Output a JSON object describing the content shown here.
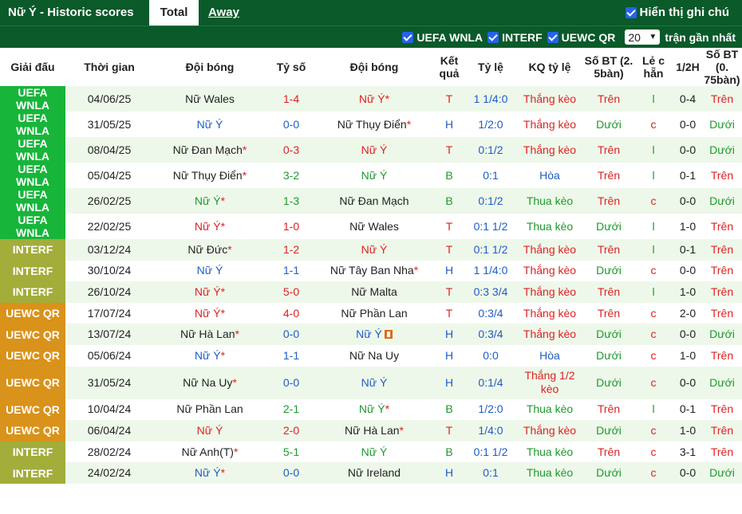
{
  "header": {
    "title": "Nữ Ý - Historic scores",
    "tab_total": "Total",
    "tab_away": "Away",
    "show_label": "Hiển thị ghi chú"
  },
  "filters": {
    "leagues": [
      "UEFA WNLA",
      "INTERF",
      "UEWC QR"
    ],
    "count": "20",
    "count_label": "trận gần nhất"
  },
  "colors": {
    "header_bg": "#0a5a2a",
    "league_uefa": "#17b53a",
    "league_interf": "#a2ad3a",
    "league_uewc": "#d9921a",
    "win": "#d22",
    "draw": "#1e5cc8",
    "loss": "#1d9a2c"
  },
  "columns": [
    "Giải đấu",
    "Thời gian",
    "Đội bóng",
    "Tỷ số",
    "Đội bóng",
    "Kết quả",
    "Tỷ lệ",
    "KQ tỷ lệ",
    "Số BT (2. 5bàn)",
    "Lẻ c hẵn",
    "1/2H",
    "Số BT (0. 75bàn)"
  ],
  "rows": [
    {
      "league": "UEFA WNLA",
      "lc": "uefa",
      "date": "04/06/25",
      "home": "Nữ Wales",
      "hc": "dark",
      "hs": false,
      "score": "1-4",
      "away": "Nữ Ý",
      "ac": "red",
      "as": true,
      "res": "T",
      "rc": "red",
      "odds": "1 1/4:0",
      "oc": "blue",
      "kq": "Thắng kèo",
      "kc": "red",
      "ou": "Trên",
      "uc": "red",
      "eo": "l",
      "ec": "green",
      "half": "0-4",
      "ou2": "Trên",
      "u2c": "red"
    },
    {
      "league": "UEFA WNLA",
      "lc": "uefa",
      "date": "31/05/25",
      "home": "Nữ Ý",
      "hc": "blue",
      "hs": false,
      "score": "0-0",
      "away": "Nữ Thụy Điển",
      "ac": "dark",
      "as": true,
      "res": "H",
      "rc": "blue",
      "odds": "1/2:0",
      "oc": "blue",
      "kq": "Thắng kèo",
      "kc": "red",
      "ou": "Dưới",
      "uc": "green",
      "eo": "c",
      "ec": "red",
      "half": "0-0",
      "ou2": "Dưới",
      "u2c": "green"
    },
    {
      "league": "UEFA WNLA",
      "lc": "uefa",
      "date": "08/04/25",
      "home": "Nữ Đan Mạch",
      "hc": "dark",
      "hs": true,
      "score": "0-3",
      "away": "Nữ Ý",
      "ac": "red",
      "as": false,
      "res": "T",
      "rc": "red",
      "odds": "0:1/2",
      "oc": "blue",
      "kq": "Thắng kèo",
      "kc": "red",
      "ou": "Trên",
      "uc": "red",
      "eo": "l",
      "ec": "green",
      "half": "0-0",
      "ou2": "Dưới",
      "u2c": "green"
    },
    {
      "league": "UEFA WNLA",
      "lc": "uefa",
      "date": "05/04/25",
      "home": "Nữ Thụy Điển",
      "hc": "dark",
      "hs": true,
      "score": "3-2",
      "away": "Nữ Ý",
      "ac": "green",
      "as": false,
      "res": "B",
      "rc": "green",
      "odds": "0:1",
      "oc": "blue",
      "kq": "Hòa",
      "kc": "blue",
      "ou": "Trên",
      "uc": "red",
      "eo": "l",
      "ec": "green",
      "half": "0-1",
      "ou2": "Trên",
      "u2c": "red"
    },
    {
      "league": "UEFA WNLA",
      "lc": "uefa",
      "date": "26/02/25",
      "home": "Nữ Ý",
      "hc": "green",
      "hs": true,
      "score": "1-3",
      "away": "Nữ Đan Mạch",
      "ac": "dark",
      "as": false,
      "res": "B",
      "rc": "green",
      "odds": "0:1/2",
      "oc": "blue",
      "kq": "Thua kèo",
      "kc": "green",
      "ou": "Trên",
      "uc": "red",
      "eo": "c",
      "ec": "red",
      "half": "0-0",
      "ou2": "Dưới",
      "u2c": "green"
    },
    {
      "league": "UEFA WNLA",
      "lc": "uefa",
      "date": "22/02/25",
      "home": "Nữ Ý",
      "hc": "red",
      "hs": true,
      "score": "1-0",
      "away": "Nữ Wales",
      "ac": "dark",
      "as": false,
      "res": "T",
      "rc": "red",
      "odds": "0:1 1/2",
      "oc": "blue",
      "kq": "Thua kèo",
      "kc": "green",
      "ou": "Dưới",
      "uc": "green",
      "eo": "l",
      "ec": "green",
      "half": "1-0",
      "ou2": "Trên",
      "u2c": "red"
    },
    {
      "league": "INTERF",
      "lc": "interf",
      "date": "03/12/24",
      "home": "Nữ Đức",
      "hc": "dark",
      "hs": true,
      "score": "1-2",
      "away": "Nữ Ý",
      "ac": "red",
      "as": false,
      "res": "T",
      "rc": "red",
      "odds": "0:1 1/2",
      "oc": "blue",
      "kq": "Thắng kèo",
      "kc": "red",
      "ou": "Trên",
      "uc": "red",
      "eo": "l",
      "ec": "green",
      "half": "0-1",
      "ou2": "Trên",
      "u2c": "red"
    },
    {
      "league": "INTERF",
      "lc": "interf",
      "date": "30/10/24",
      "home": "Nữ Ý",
      "hc": "blue",
      "hs": false,
      "score": "1-1",
      "away": "Nữ Tây Ban Nha",
      "ac": "dark",
      "as": true,
      "res": "H",
      "rc": "blue",
      "odds": "1 1/4:0",
      "oc": "blue",
      "kq": "Thắng kèo",
      "kc": "red",
      "ou": "Dưới",
      "uc": "green",
      "eo": "c",
      "ec": "red",
      "half": "0-0",
      "ou2": "Trên",
      "u2c": "red"
    },
    {
      "league": "INTERF",
      "lc": "interf",
      "date": "26/10/24",
      "home": "Nữ Ý",
      "hc": "red",
      "hs": true,
      "score": "5-0",
      "away": "Nữ Malta",
      "ac": "dark",
      "as": false,
      "res": "T",
      "rc": "red",
      "odds": "0:3 3/4",
      "oc": "blue",
      "kq": "Thắng kèo",
      "kc": "red",
      "ou": "Trên",
      "uc": "red",
      "eo": "l",
      "ec": "green",
      "half": "1-0",
      "ou2": "Trên",
      "u2c": "red"
    },
    {
      "league": "UEWC QR",
      "lc": "uewc",
      "date": "17/07/24",
      "home": "Nữ Ý",
      "hc": "red",
      "hs": true,
      "score": "4-0",
      "away": "Nữ Phần Lan",
      "ac": "dark",
      "as": false,
      "res": "T",
      "rc": "red",
      "odds": "0:3/4",
      "oc": "blue",
      "kq": "Thắng kèo",
      "kc": "red",
      "ou": "Trên",
      "uc": "red",
      "eo": "c",
      "ec": "red",
      "half": "2-0",
      "ou2": "Trên",
      "u2c": "red"
    },
    {
      "league": "UEWC QR",
      "lc": "uewc",
      "date": "13/07/24",
      "home": "Nữ Hà Lan",
      "hc": "dark",
      "hs": true,
      "score": "0-0",
      "away": "Nữ Ý",
      "ac": "blue",
      "as": false,
      "flag": true,
      "res": "H",
      "rc": "blue",
      "odds": "0:3/4",
      "oc": "blue",
      "kq": "Thắng kèo",
      "kc": "red",
      "ou": "Dưới",
      "uc": "green",
      "eo": "c",
      "ec": "red",
      "half": "0-0",
      "ou2": "Dưới",
      "u2c": "green"
    },
    {
      "league": "UEWC QR",
      "lc": "uewc",
      "date": "05/06/24",
      "home": "Nữ Ý",
      "hc": "blue",
      "hs": true,
      "score": "1-1",
      "away": "Nữ Na Uy",
      "ac": "dark",
      "as": false,
      "res": "H",
      "rc": "blue",
      "odds": "0:0",
      "oc": "blue",
      "kq": "Hòa",
      "kc": "blue",
      "ou": "Dưới",
      "uc": "green",
      "eo": "c",
      "ec": "red",
      "half": "1-0",
      "ou2": "Trên",
      "u2c": "red"
    },
    {
      "league": "UEWC QR",
      "lc": "uewc",
      "date": "31/05/24",
      "home": "Nữ Na Uy",
      "hc": "dark",
      "hs": true,
      "score": "0-0",
      "away": "Nữ Ý",
      "ac": "blue",
      "as": false,
      "res": "H",
      "rc": "blue",
      "odds": "0:1/4",
      "oc": "blue",
      "kq": "Thắng 1/2 kèo",
      "kc": "red",
      "ou": "Dưới",
      "uc": "green",
      "eo": "c",
      "ec": "red",
      "half": "0-0",
      "ou2": "Dưới",
      "u2c": "green",
      "tall": true
    },
    {
      "league": "UEWC QR",
      "lc": "uewc",
      "date": "10/04/24",
      "home": "Nữ Phần Lan",
      "hc": "dark",
      "hs": false,
      "score": "2-1",
      "away": "Nữ Ý",
      "ac": "green",
      "as": true,
      "res": "B",
      "rc": "green",
      "odds": "1/2:0",
      "oc": "blue",
      "kq": "Thua kèo",
      "kc": "green",
      "ou": "Trên",
      "uc": "red",
      "eo": "l",
      "ec": "green",
      "half": "0-1",
      "ou2": "Trên",
      "u2c": "red"
    },
    {
      "league": "UEWC QR",
      "lc": "uewc",
      "date": "06/04/24",
      "home": "Nữ Ý",
      "hc": "red",
      "hs": false,
      "score": "2-0",
      "away": "Nữ Hà Lan",
      "ac": "dark",
      "as": true,
      "res": "T",
      "rc": "red",
      "odds": "1/4:0",
      "oc": "blue",
      "kq": "Thắng kèo",
      "kc": "red",
      "ou": "Dưới",
      "uc": "green",
      "eo": "c",
      "ec": "red",
      "half": "1-0",
      "ou2": "Trên",
      "u2c": "red"
    },
    {
      "league": "INTERF",
      "lc": "interf",
      "date": "28/02/24",
      "home": "Nữ Anh(T)",
      "hc": "dark",
      "hs": true,
      "score": "5-1",
      "away": "Nữ Ý",
      "ac": "green",
      "as": false,
      "res": "B",
      "rc": "green",
      "odds": "0:1 1/2",
      "oc": "blue",
      "kq": "Thua kèo",
      "kc": "green",
      "ou": "Trên",
      "uc": "red",
      "eo": "c",
      "ec": "red",
      "half": "3-1",
      "ou2": "Trên",
      "u2c": "red"
    },
    {
      "league": "INTERF",
      "lc": "interf",
      "date": "24/02/24",
      "home": "Nữ Ý",
      "hc": "blue",
      "hs": true,
      "score": "0-0",
      "away": "Nữ Ireland",
      "ac": "dark",
      "as": false,
      "res": "H",
      "rc": "blue",
      "odds": "0:1",
      "oc": "blue",
      "kq": "Thua kèo",
      "kc": "green",
      "ou": "Dưới",
      "uc": "green",
      "eo": "c",
      "ec": "red",
      "half": "0-0",
      "ou2": "Dưới",
      "u2c": "green"
    }
  ]
}
